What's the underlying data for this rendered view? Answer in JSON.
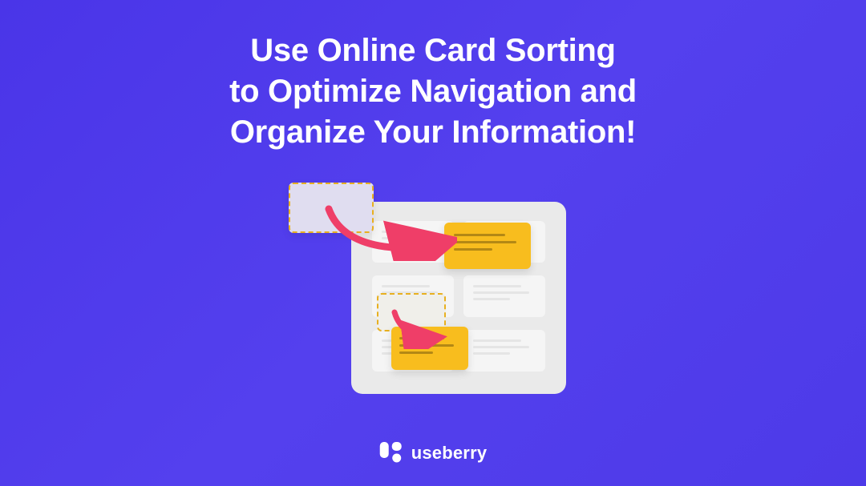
{
  "headline": "Use Online Card Sorting\nto Optimize Navigation and\nOrganize Your Information!",
  "brand": {
    "name": "useberry"
  }
}
